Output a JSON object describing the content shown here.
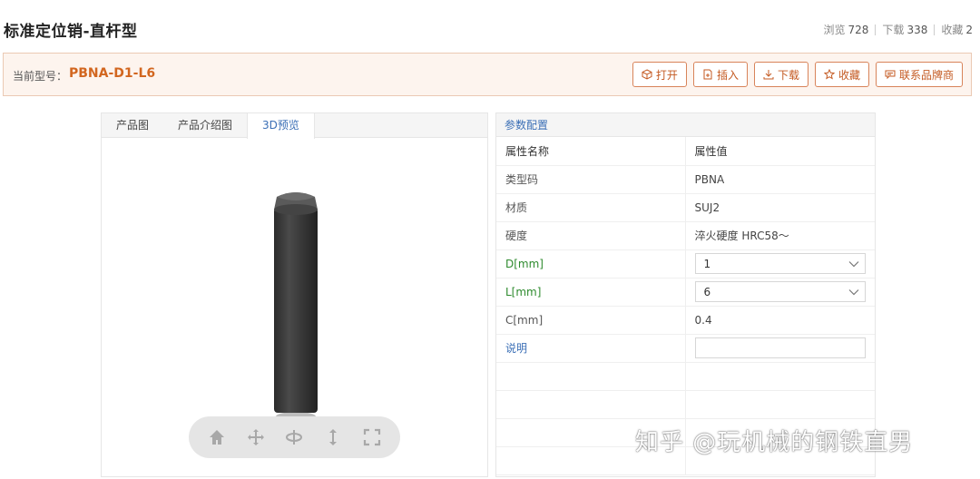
{
  "header": {
    "title": "标准定位销-直杆型",
    "stats": [
      {
        "label": "浏览",
        "value": "728"
      },
      {
        "label": "下载",
        "value": "338"
      },
      {
        "label": "收藏",
        "value": "2"
      }
    ]
  },
  "model_bar": {
    "label": "当前型号：",
    "value": "PBNA-D1-L6",
    "actions": [
      {
        "label": "打开",
        "icon": "cube-icon"
      },
      {
        "label": "插入",
        "icon": "insert-icon"
      },
      {
        "label": "下载",
        "icon": "download-icon"
      },
      {
        "label": "收藏",
        "icon": "star-icon"
      },
      {
        "label": "联系品牌商",
        "icon": "message-icon"
      }
    ]
  },
  "tabs": [
    {
      "label": "产品图",
      "active": false
    },
    {
      "label": "产品介绍图",
      "active": false
    },
    {
      "label": "3D预览",
      "active": true
    }
  ],
  "viewer_tools": [
    "home-icon",
    "pan-icon",
    "rotate-icon",
    "zoom-icon",
    "fullscreen-icon"
  ],
  "params": {
    "title": "参数配置",
    "head": {
      "name": "属性名称",
      "value": "属性值"
    },
    "rows": [
      {
        "name": "类型码",
        "value": "PBNA"
      },
      {
        "name": "材质",
        "value": "SUJ2"
      },
      {
        "name": "硬度",
        "value": "淬火硬度 HRC58～"
      },
      {
        "name": "D[mm]",
        "value": "1"
      },
      {
        "name": "L[mm]",
        "value": "6"
      },
      {
        "name": "C[mm]",
        "value": "0.4"
      },
      {
        "name": "说明",
        "value": ""
      }
    ]
  },
  "watermark": "知乎 @玩机械的钢铁直男",
  "colors": {
    "accent": "#d2661f",
    "link_blue": "#3b6fb6",
    "param_green": "#2e8b2e",
    "bar_bg": "#fdf4ee"
  }
}
